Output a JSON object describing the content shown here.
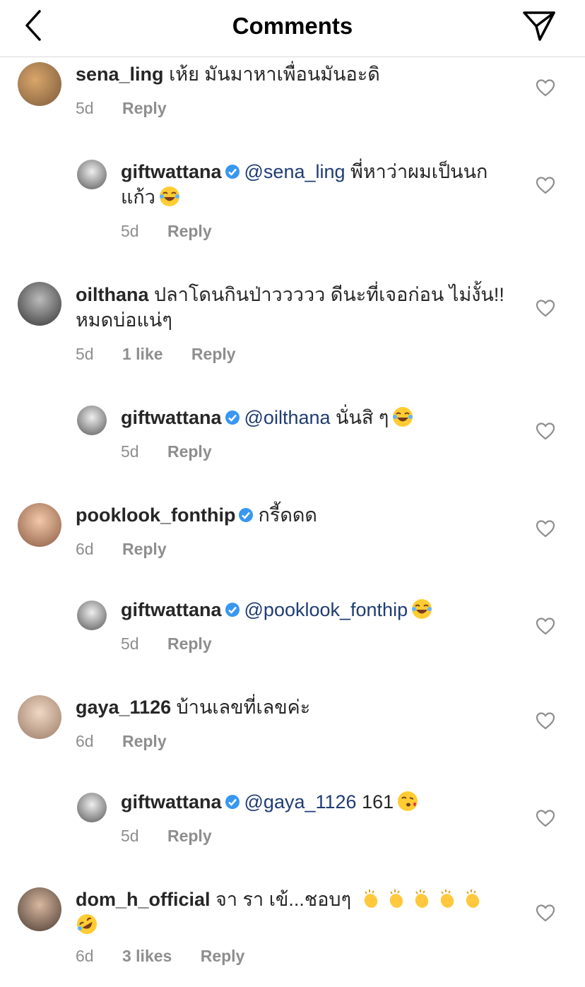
{
  "header": {
    "title": "Comments"
  },
  "comments": [
    {
      "username": "sena_ling",
      "text": "เห้ย มันมาหาเพื่อนมันอะดิ",
      "time": "5d",
      "likes": "",
      "reply": "Reply"
    },
    {
      "username": "giftwattana",
      "mention": "@sena_ling",
      "text": "พี่หาว่าผมเป็นนก",
      "text2": "แก้ว",
      "emoji": "joy-emoji",
      "time": "5d",
      "reply": "Reply"
    },
    {
      "username": "oilthana",
      "text": "ปลาโดนกินป่าววววว ดีนะที่เจอก่อน ไม่งั้น!!",
      "text2": "หมดบ่อแน่ๆ",
      "time": "5d",
      "likes": "1 like",
      "reply": "Reply"
    },
    {
      "username": "giftwattana",
      "mention": "@oilthana",
      "text": "นั่นสิ ๆ",
      "emoji": "joy-emoji",
      "time": "5d",
      "reply": "Reply"
    },
    {
      "username": "pooklook_fonthip",
      "text": "กรี้ดดด",
      "time": "6d",
      "reply": "Reply"
    },
    {
      "username": "giftwattana",
      "mention": "@pooklook_fonthip",
      "emoji": "joy-emoji",
      "time": "5d",
      "reply": "Reply"
    },
    {
      "username": "gaya_1126",
      "text": "บ้านเลขที่เลขค่ะ",
      "time": "6d",
      "reply": "Reply"
    },
    {
      "username": "giftwattana",
      "mention": "@gaya_1126",
      "text": "161",
      "emoji": "kiss-emoji",
      "time": "5d",
      "reply": "Reply"
    },
    {
      "username": "dom_h_official",
      "text": "จา รา เข้...ชอบๆ",
      "emoji": "clap-emoji x5, rofl-emoji",
      "time": "6d",
      "likes": "3 likes",
      "reply": "Reply"
    }
  ],
  "colors": {
    "mention": "#1f3c73",
    "verified": "#3897f0",
    "meta": "#8e8e8e"
  }
}
